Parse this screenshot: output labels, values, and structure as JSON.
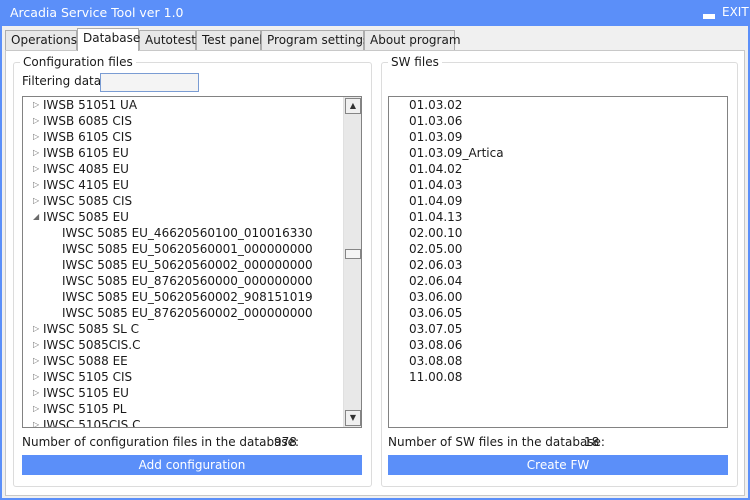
{
  "window": {
    "title": "Arcadia Service Tool ver 1.0",
    "exit_label": "EXIT"
  },
  "tabs": [
    {
      "label": "Operations",
      "active": false
    },
    {
      "label": "Database",
      "active": true
    },
    {
      "label": "Autotest",
      "active": false
    },
    {
      "label": "Test panel",
      "active": false
    },
    {
      "label": "Program settings",
      "active": false
    },
    {
      "label": "About program",
      "active": false
    }
  ],
  "config": {
    "group_title": "Configuration files",
    "filter_label": "Filtering data",
    "filter_value": "",
    "tree": [
      {
        "label": "IWSB 51051 UA",
        "expander": "collapsed",
        "level": 0
      },
      {
        "label": "IWSB 6085 CIS",
        "expander": "collapsed",
        "level": 0
      },
      {
        "label": "IWSB 6105 CIS",
        "expander": "collapsed",
        "level": 0
      },
      {
        "label": "IWSB 6105 EU",
        "expander": "collapsed",
        "level": 0
      },
      {
        "label": "IWSC 4085 EU",
        "expander": "collapsed",
        "level": 0
      },
      {
        "label": "IWSC 4105 EU",
        "expander": "collapsed",
        "level": 0
      },
      {
        "label": "IWSC 5085 CIS",
        "expander": "collapsed",
        "level": 0
      },
      {
        "label": "IWSC 5085 EU",
        "expander": "expanded",
        "level": 0
      },
      {
        "label": "IWSC 5085 EU_46620560100_010016330",
        "expander": "none",
        "level": 1
      },
      {
        "label": "IWSC 5085 EU_50620560001_000000000",
        "expander": "none",
        "level": 1
      },
      {
        "label": "IWSC 5085 EU_50620560002_000000000",
        "expander": "none",
        "level": 1
      },
      {
        "label": "IWSC 5085 EU_87620560000_000000000",
        "expander": "none",
        "level": 1
      },
      {
        "label": "IWSC 5085 EU_50620560002_908151019",
        "expander": "none",
        "level": 1
      },
      {
        "label": "IWSC 5085 EU_87620560002_000000000",
        "expander": "none",
        "level": 1
      },
      {
        "label": "IWSC 5085 SL C",
        "expander": "collapsed",
        "level": 0
      },
      {
        "label": "IWSC 5085CIS.C",
        "expander": "collapsed",
        "level": 0
      },
      {
        "label": "IWSC 5088 EE",
        "expander": "collapsed",
        "level": 0
      },
      {
        "label": "IWSC 5105 CIS",
        "expander": "collapsed",
        "level": 0
      },
      {
        "label": "IWSC 5105 EU",
        "expander": "collapsed",
        "level": 0
      },
      {
        "label": "IWSC 5105 PL",
        "expander": "collapsed",
        "level": 0
      },
      {
        "label": "IWSC 5105CIS.C",
        "expander": "collapsed",
        "level": 0
      }
    ],
    "count_label": "Number of configuration files in the database:",
    "count_value": "978",
    "add_button": "Add configuration"
  },
  "sw": {
    "group_title": "SW files",
    "files": [
      "01.03.02",
      "01.03.06",
      "01.03.09",
      "01.03.09_Artica",
      "01.04.02",
      "01.04.03",
      "01.04.09",
      "01.04.13",
      "02.00.10",
      "02.05.00",
      "02.06.03",
      "02.06.04",
      "03.06.00",
      "03.06.05",
      "03.07.05",
      "03.08.06",
      "03.08.08",
      "11.00.08"
    ],
    "count_label": "Number of SW files in the database:",
    "count_value": "18",
    "create_button": "Create FW"
  },
  "icons": {
    "minimize": "minimize-icon",
    "expander_collapsed": "triangle-right-icon",
    "expander_expanded": "triangle-down-icon",
    "scroll_up": "arrow-up-icon",
    "scroll_down": "arrow-down-icon"
  },
  "colors": {
    "accent": "#5b8ff9",
    "background": "#f0f0f0"
  }
}
